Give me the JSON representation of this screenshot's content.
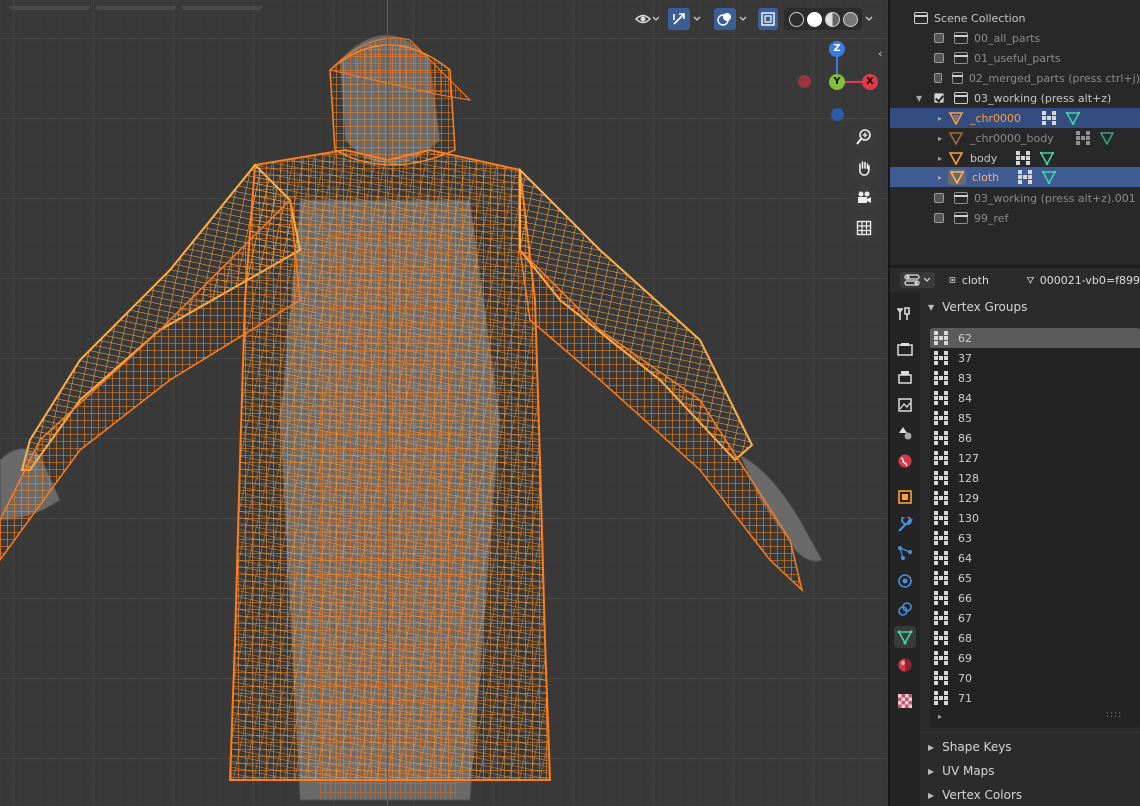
{
  "viewport": {
    "gizmo": {
      "z": "Z",
      "y": "Y",
      "x": "X"
    },
    "colors": {
      "wire": "#ff7a1a",
      "wire_light": "#ffae45",
      "axis_blue": "#2f63c4",
      "selection_blue": "#3e5b94"
    }
  },
  "outliner": {
    "root": "Scene Collection",
    "items": [
      {
        "label": "00_all_parts",
        "type": "collection"
      },
      {
        "label": "01_useful_parts",
        "type": "collection"
      },
      {
        "label": "02_merged_parts (press ctrl+j)",
        "type": "collection"
      },
      {
        "label": "03_working (press alt+z)",
        "type": "collection",
        "checked": true,
        "expanded": true
      },
      {
        "label": "_chr0000",
        "type": "mesh",
        "selected": true
      },
      {
        "label": "_chr0000_body",
        "type": "mesh"
      },
      {
        "label": "body",
        "type": "mesh"
      },
      {
        "label": "cloth",
        "type": "mesh",
        "active": true
      },
      {
        "label": "03_working (press alt+z).001",
        "type": "collection"
      },
      {
        "label": "99_ref",
        "type": "collection"
      }
    ]
  },
  "properties": {
    "object_name": "cloth",
    "mesh_name": "000021-vb0=f899",
    "vertex_groups_title": "Vertex Groups",
    "vertex_groups": [
      "62",
      "37",
      "83",
      "84",
      "85",
      "86",
      "127",
      "128",
      "129",
      "130",
      "63",
      "64",
      "65",
      "66",
      "67",
      "68",
      "69",
      "70",
      "71"
    ],
    "active_group": "62",
    "panels": [
      "Shape Keys",
      "UV Maps",
      "Vertex Colors"
    ]
  }
}
